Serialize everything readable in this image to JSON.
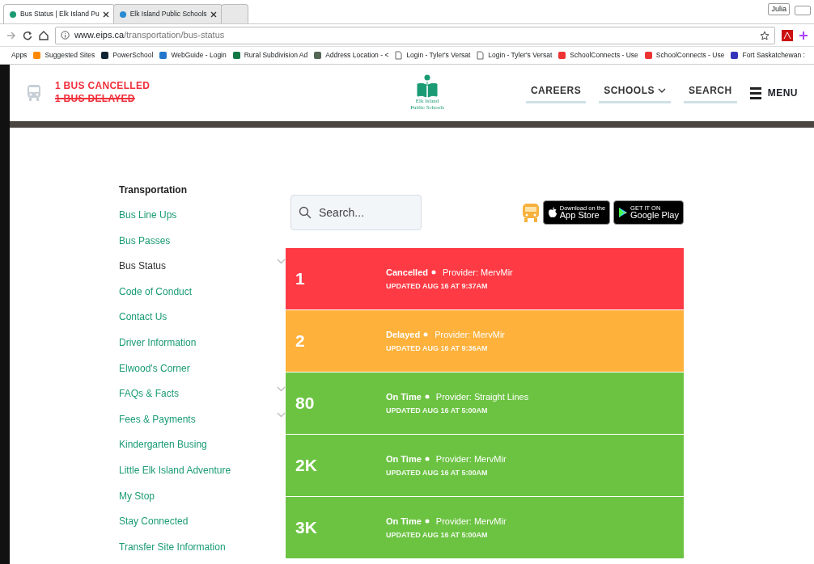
{
  "browser": {
    "tabs": [
      {
        "title": "Bus Status | Elk Island Pu",
        "selected": true
      },
      {
        "title": "Elk Island Public Schools",
        "selected": false
      }
    ],
    "profile": "Julia",
    "url": {
      "host": "www.eips.ca",
      "path": "/transportation/bus-status"
    },
    "bookmarks": [
      "Apps",
      "Suggested Sites",
      "PowerSchool",
      "WebGuide - Login",
      "Rural Subdivision Ad",
      "Address Location - <",
      "Login - Tyler's Versat",
      "Login - Tyler's Versat",
      "SchoolConnects - Use",
      "SchoolConnects - Use",
      "Fort Saskatchewan : "
    ]
  },
  "header": {
    "alerts": [
      {
        "text": "1 BUS CANCELLED",
        "struck": false
      },
      {
        "text": "1 BUS DELAYED",
        "struck": true
      }
    ],
    "logo": {
      "line1": "Elk Island",
      "line2": "Public Schools"
    },
    "nav": [
      {
        "label": "CAREERS",
        "dropdown": false
      },
      {
        "label": "SCHOOLS",
        "dropdown": true
      },
      {
        "label": "SEARCH",
        "dropdown": false
      }
    ],
    "menu": "MENU"
  },
  "sidebar": {
    "title": "Transportation",
    "items": [
      {
        "label": "Bus Line Ups",
        "selected": false,
        "expandable": false
      },
      {
        "label": "Bus Passes",
        "selected": false,
        "expandable": false
      },
      {
        "label": "Bus Status",
        "selected": true,
        "expandable": true
      },
      {
        "label": "Code of Conduct",
        "selected": false,
        "expandable": false
      },
      {
        "label": "Contact Us",
        "selected": false,
        "expandable": false
      },
      {
        "label": "Driver Information",
        "selected": false,
        "expandable": false
      },
      {
        "label": "Elwood's Corner",
        "selected": false,
        "expandable": false
      },
      {
        "label": "FAQs & Facts",
        "selected": false,
        "expandable": true
      },
      {
        "label": "Fees & Payments",
        "selected": false,
        "expandable": true
      },
      {
        "label": "Kindergarten Busing",
        "selected": false,
        "expandable": false
      },
      {
        "label": "Little Elk Island Adventure",
        "selected": false,
        "expandable": false
      },
      {
        "label": "My Stop",
        "selected": false,
        "expandable": false
      },
      {
        "label": "Stay Connected",
        "selected": false,
        "expandable": false
      },
      {
        "label": "Transfer Site Information",
        "selected": false,
        "expandable": false
      }
    ]
  },
  "search": {
    "placeholder": "Search..."
  },
  "app_badges": [
    {
      "small": "Download on the",
      "big": "App Store",
      "kind": "apple"
    },
    {
      "small": "GET IT ON",
      "big": "Google Play",
      "kind": "google"
    }
  ],
  "buses": [
    {
      "number": "1",
      "status": "Cancelled",
      "provider": "Provider: MervMir",
      "updated": "UPDATED AUG 16 AT 9:37AM",
      "color": "#fe3a44"
    },
    {
      "number": "2",
      "status": "Delayed",
      "provider": "Provider: MervMir",
      "updated": "UPDATED AUG 16 AT 9:36AM",
      "color": "#feb13b"
    },
    {
      "number": "80",
      "status": "On Time",
      "provider": "Provider: Straight Lines",
      "updated": "UPDATED AUG 16 AT 5:00AM",
      "color": "#6cc342"
    },
    {
      "number": "2K",
      "status": "On Time",
      "provider": "Provider: MervMir",
      "updated": "UPDATED AUG 16 AT 5:00AM",
      "color": "#6cc342"
    },
    {
      "number": "3K",
      "status": "On Time",
      "provider": "Provider: MervMir",
      "updated": "UPDATED AUG 16 AT 5:00AM",
      "color": "#6cc342"
    }
  ]
}
